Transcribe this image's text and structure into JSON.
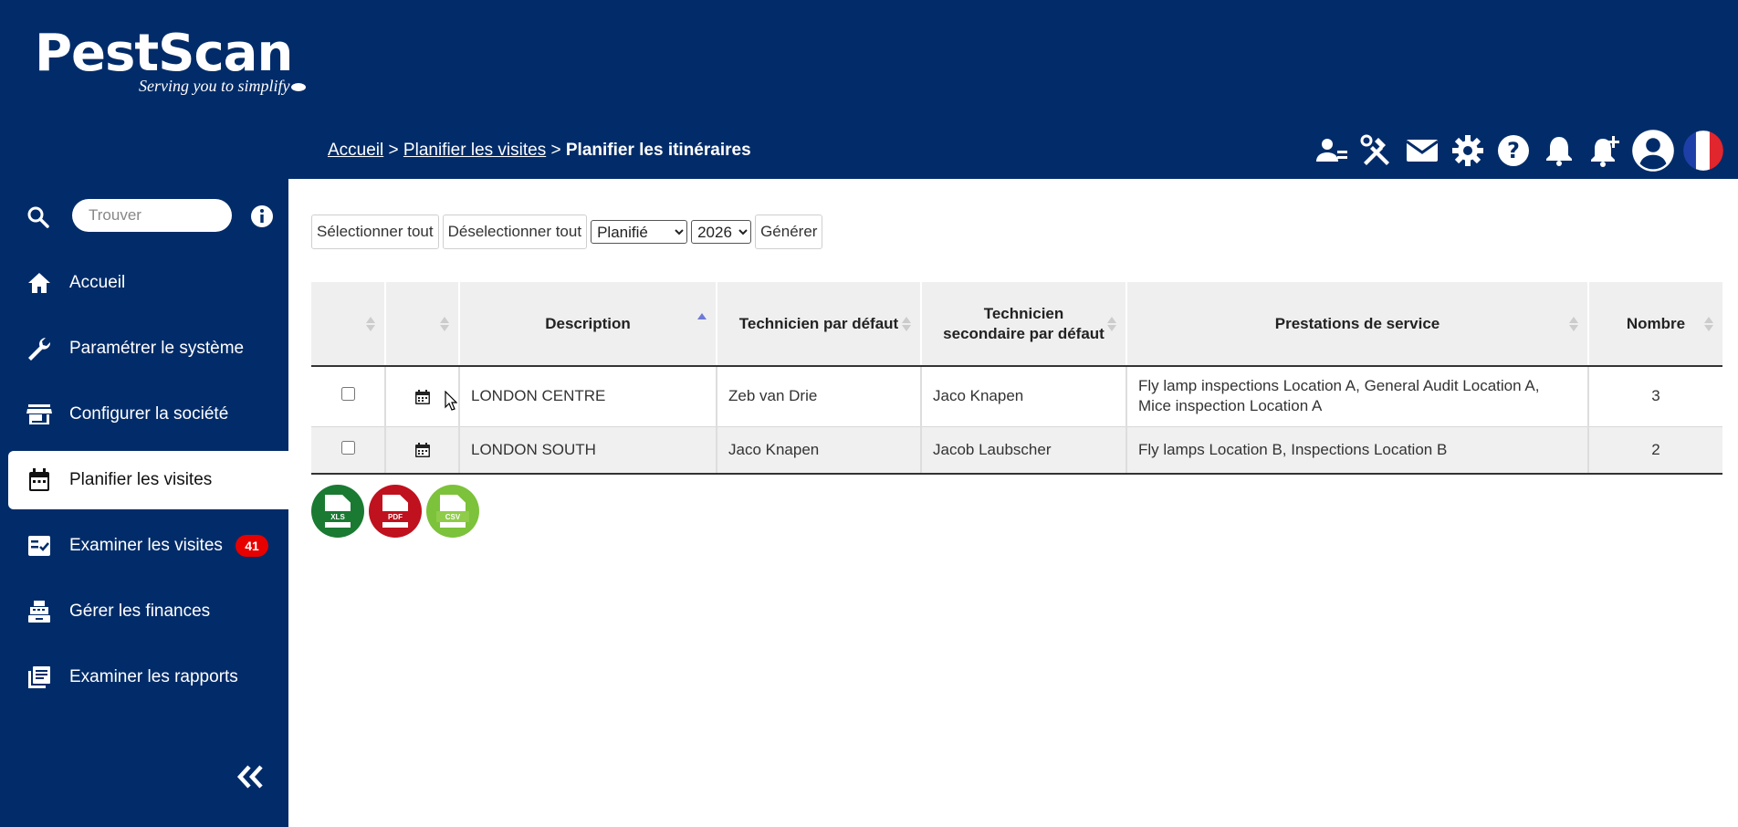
{
  "brand": {
    "name": "PestScan",
    "tagline": "Serving you to simplify"
  },
  "breadcrumb": {
    "items": [
      "Accueil",
      "Planifier les visites"
    ],
    "separator": ">",
    "current": "Planifier les itinéraires"
  },
  "header_icons": [
    "users-icon",
    "tools-icon",
    "mail-icon",
    "gear-icon",
    "help-icon",
    "bell-icon",
    "bell-plus-icon",
    "account-icon",
    "french-flag-icon"
  ],
  "sidebar": {
    "search_placeholder": "Trouver",
    "items": [
      {
        "label": "Accueil",
        "icon": "home-icon"
      },
      {
        "label": "Paramétrer le système",
        "icon": "wrench-icon"
      },
      {
        "label": "Configurer la société",
        "icon": "store-icon"
      },
      {
        "label": "Planifier les visites",
        "icon": "calendar-icon",
        "active": true
      },
      {
        "label": "Examiner les visites",
        "icon": "checklist-icon",
        "badge": "41"
      },
      {
        "label": "Gérer les finances",
        "icon": "cash-register-icon"
      },
      {
        "label": "Examiner les rapports",
        "icon": "reports-icon"
      }
    ]
  },
  "toolbar": {
    "select_all": "Sélectionner tout",
    "deselect_all": "Déselectionner tout",
    "status_selected": "Planifié",
    "year_selected": "2026",
    "generate": "Générer"
  },
  "table": {
    "headers": [
      "",
      "",
      "Description",
      "Technicien par défaut",
      "Technicien secondaire par défaut",
      "Prestations de service",
      "Nombre"
    ],
    "rows": [
      {
        "description": "LONDON CENTRE",
        "technician": "Zeb van Drie",
        "secondary": "Jaco Knapen",
        "services": "Fly lamp inspections Location A, General Audit Location A, Mice inspection Location A",
        "count": "3"
      },
      {
        "description": "LONDON SOUTH",
        "technician": "Jaco Knapen",
        "secondary": "Jacob Laubscher",
        "services": "Fly lamps Location B, Inspections Location B",
        "count": "2"
      }
    ]
  },
  "exports": [
    {
      "label": "XLS",
      "color": "#1a7a32"
    },
    {
      "label": "PDF",
      "color": "#c0111e"
    },
    {
      "label": "CSV",
      "color": "#7cc23a"
    }
  ],
  "colors": {
    "navy": "#022c69",
    "badge": "#e60000",
    "sort_active": "#6f7ad6"
  }
}
